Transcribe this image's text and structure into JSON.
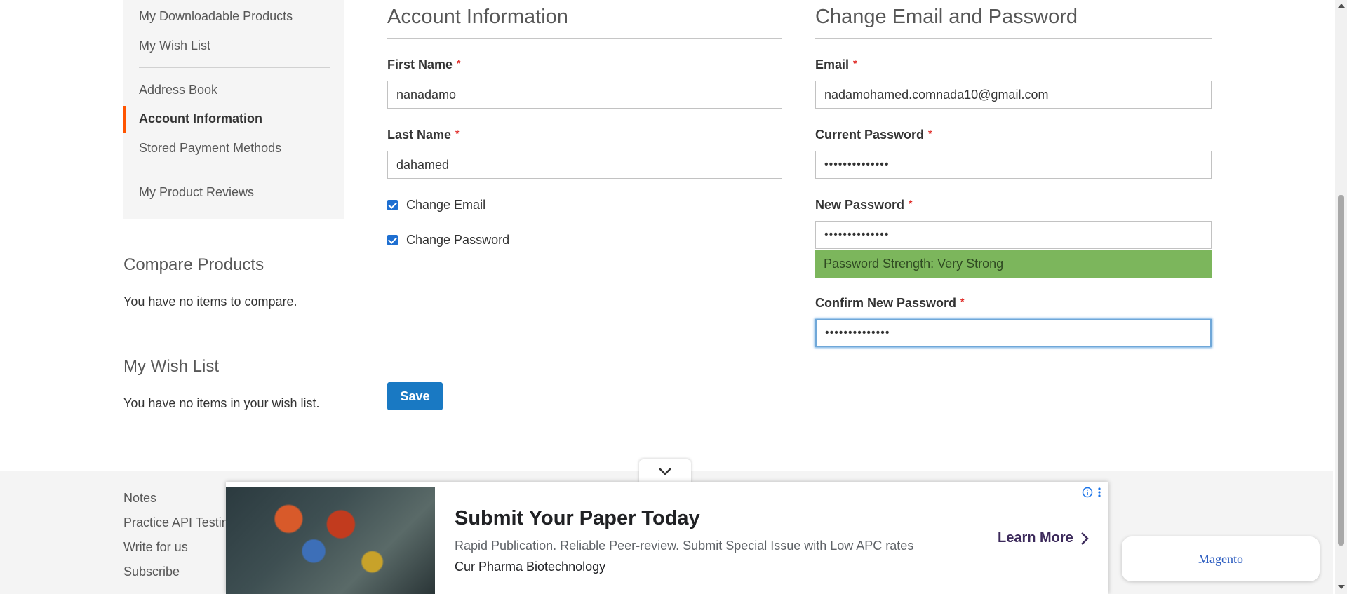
{
  "sidebar": {
    "items": [
      {
        "label": "My Downloadable Products"
      },
      {
        "label": "My Wish List"
      },
      {
        "label": "Address Book"
      },
      {
        "label": "Account Information"
      },
      {
        "label": "Stored Payment Methods"
      },
      {
        "label": "My Product Reviews"
      }
    ],
    "active": "Account Information"
  },
  "compare": {
    "title": "Compare Products",
    "text": "You have no items to compare."
  },
  "wishlist": {
    "title": "My Wish List",
    "text": "You have no items in your wish list."
  },
  "account_info": {
    "title": "Account Information",
    "first_name_label": "First Name",
    "first_name_value": "nanadamo",
    "last_name_label": "Last Name",
    "last_name_value": "dahamed",
    "change_email_label": "Change Email",
    "change_password_label": "Change Password",
    "required_mark": "*"
  },
  "email_password": {
    "title": "Change Email and Password",
    "email_label": "Email",
    "email_value": "nadamohamed.comnada10@gmail.com",
    "current_password_label": "Current Password",
    "current_password_value": "••••••••••••••",
    "new_password_label": "New Password",
    "new_password_value": "••••••••••••••",
    "strength_text": "Password Strength: Very Strong",
    "confirm_password_label": "Confirm New Password",
    "confirm_password_value": "••••••••••••••"
  },
  "save_label": "Save",
  "footer": {
    "links": [
      "Notes",
      "Practice API Testin",
      "Write for us",
      "Subscribe"
    ]
  },
  "ad": {
    "headline": "Submit Your Paper Today",
    "description": "Rapid Publication. Reliable Peer-review. Submit Special Issue with Low APC rates",
    "source": "Cur Pharma Biotechnology",
    "cta": "Learn More"
  },
  "magento_label": "Magento",
  "colors": {
    "accent": "#1979c3",
    "active_marker": "#ff5501",
    "strength": "#7cb65c",
    "required": "#e02b27"
  }
}
